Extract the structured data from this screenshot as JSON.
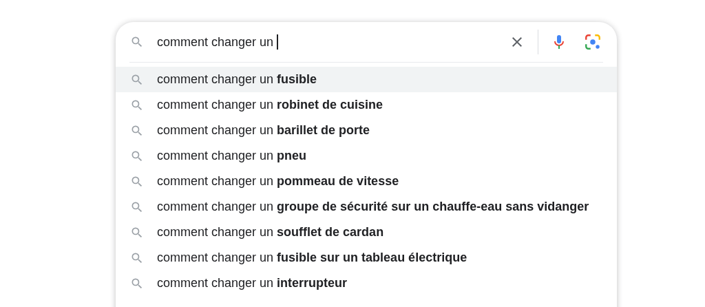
{
  "search": {
    "value": "comment changer un "
  },
  "suggestions": [
    {
      "text": "comment changer un **fusible**",
      "selected": true
    },
    {
      "text": "comment changer un **robinet de cuisine**",
      "selected": false
    },
    {
      "text": "comment changer un **barillet de porte**",
      "selected": false
    },
    {
      "text": "comment changer un **pneu**",
      "selected": false
    },
    {
      "text": "comment changer un **pommeau de vitesse**",
      "selected": false
    },
    {
      "text": "comment changer un **groupe de sécurité sur un chauffe-eau sans vidanger**",
      "selected": false
    },
    {
      "text": "comment changer un **soufflet de cardan**",
      "selected": false
    },
    {
      "text": "comment changer un **fusible sur un tableau électrique**",
      "selected": false
    },
    {
      "text": "comment changer un **interrupteur**",
      "selected": false
    }
  ]
}
